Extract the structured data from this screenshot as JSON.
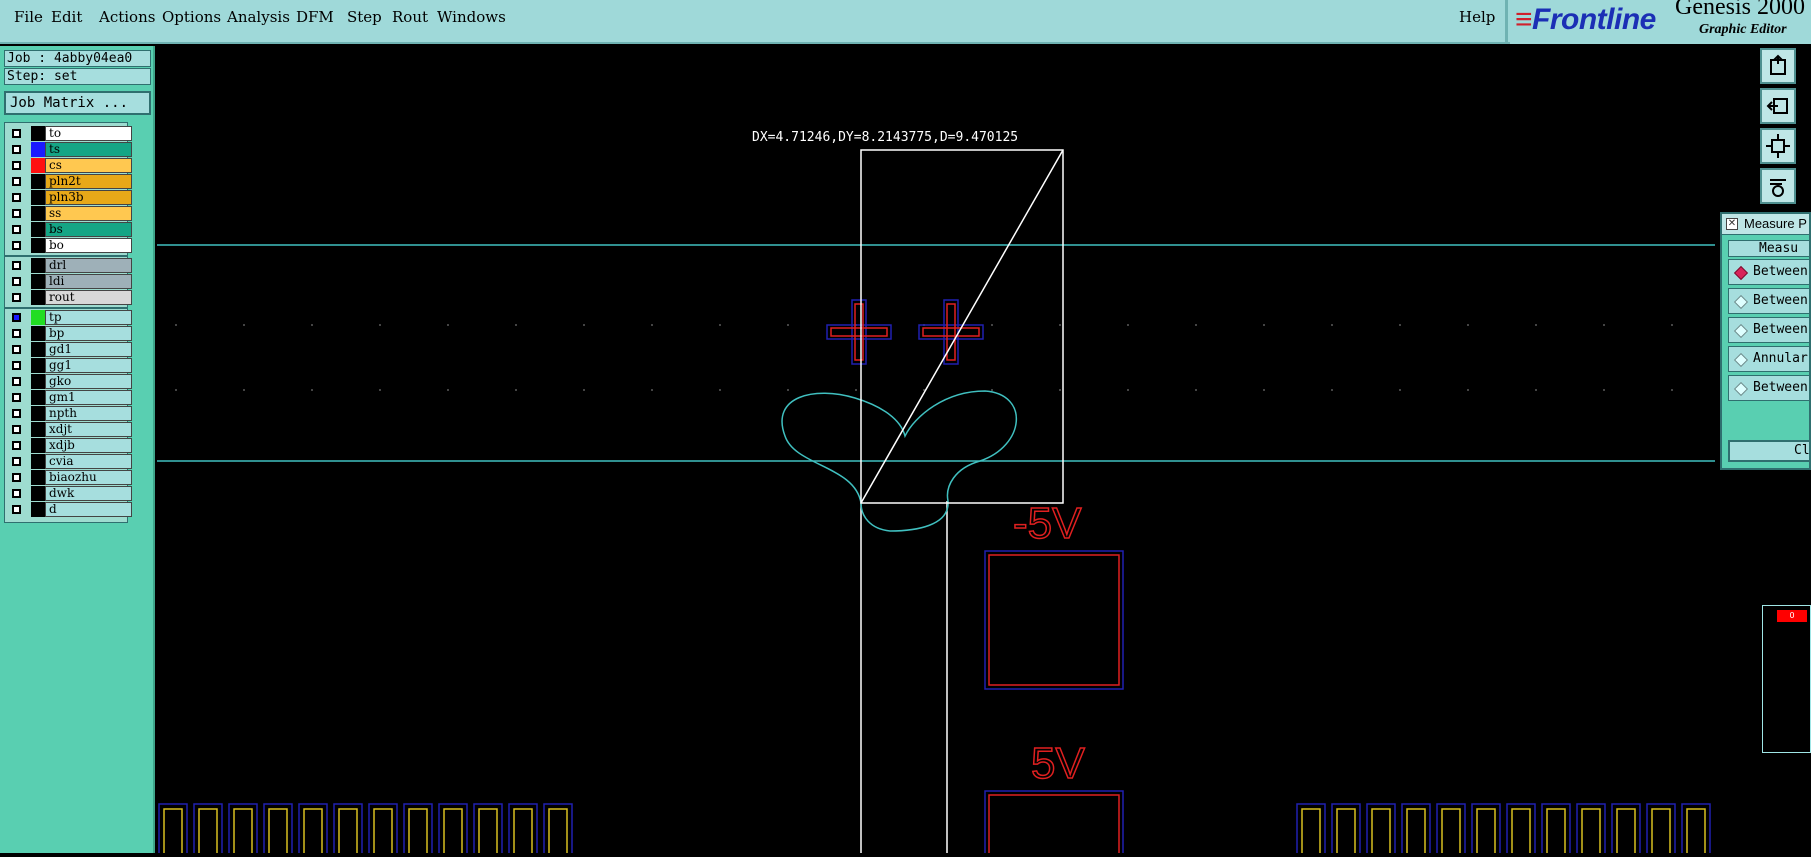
{
  "menubar": {
    "items": [
      {
        "label": "File"
      },
      {
        "label": "Edit"
      },
      {
        "label": "Actions"
      },
      {
        "label": "Options"
      },
      {
        "label": "Analysis"
      },
      {
        "label": "DFM"
      },
      {
        "label": "Step"
      },
      {
        "label": "Rout"
      },
      {
        "label": "Windows"
      }
    ],
    "help": "Help"
  },
  "brand": {
    "logo": "Frontline",
    "title": "Genesis 2000",
    "subtitle": "Graphic Editor"
  },
  "job_info": {
    "job": "Job : 4abby04ea0",
    "step": "Step: set",
    "job_matrix_button": "Job Matrix ..."
  },
  "layers": [
    {
      "name": "to",
      "swatch": "#000000",
      "bg": "#ffffff",
      "active": false
    },
    {
      "name": "ts",
      "swatch": "#1a1aff",
      "bg": "#15a585",
      "active": false
    },
    {
      "name": "cs",
      "swatch": "#ff1010",
      "bg": "#ffc850",
      "active": false
    },
    {
      "name": "pln2t",
      "swatch": "#000000",
      "bg": "#e8a818",
      "active": false
    },
    {
      "name": "pln3b",
      "swatch": "#000000",
      "bg": "#e8a818",
      "active": false
    },
    {
      "name": "ss",
      "swatch": "#000000",
      "bg": "#ffc850",
      "active": false
    },
    {
      "name": "bs",
      "swatch": "#000000",
      "bg": "#15a585",
      "active": false
    },
    {
      "name": "bo",
      "swatch": "#000000",
      "bg": "#ffffff",
      "active": false
    },
    {
      "name": "drl",
      "swatch": "#000000",
      "bg": "#9eb0b8",
      "active": false
    },
    {
      "name": "ldi",
      "swatch": "#000000",
      "bg": "#9eb0b8",
      "active": false
    },
    {
      "name": "rout",
      "swatch": "#000000",
      "bg": "#d8d8d8",
      "active": false
    },
    {
      "name": "tp",
      "swatch": "#22dd22",
      "bg": "#a6dede",
      "active": true
    },
    {
      "name": "bp",
      "swatch": "#000000",
      "bg": "#a6dede",
      "active": false
    },
    {
      "name": "gd1",
      "swatch": "#000000",
      "bg": "#a6dede",
      "active": false
    },
    {
      "name": "gg1",
      "swatch": "#000000",
      "bg": "#a6dede",
      "active": false
    },
    {
      "name": "gko",
      "swatch": "#000000",
      "bg": "#a6dede",
      "active": false
    },
    {
      "name": "gm1",
      "swatch": "#000000",
      "bg": "#a6dede",
      "active": false
    },
    {
      "name": "npth",
      "swatch": "#000000",
      "bg": "#a6dede",
      "active": false
    },
    {
      "name": "xdjt",
      "swatch": "#000000",
      "bg": "#a6dede",
      "active": false
    },
    {
      "name": "xdjb",
      "swatch": "#000000",
      "bg": "#a6dede",
      "active": false
    },
    {
      "name": "cvia",
      "swatch": "#000000",
      "bg": "#a6dede",
      "active": false
    },
    {
      "name": "biaozhu",
      "swatch": "#000000",
      "bg": "#a6dede",
      "active": false
    },
    {
      "name": "dwk",
      "swatch": "#000000",
      "bg": "#a6dede",
      "active": false
    },
    {
      "name": "d",
      "swatch": "#000000",
      "bg": "#a6dede",
      "active": false
    }
  ],
  "canvas": {
    "measure_readout": "DX=4.71246,DY=8.2143775,D=9.470125",
    "labels": [
      "-5V",
      "5V"
    ]
  },
  "measure_popup": {
    "title": "Measure P",
    "header": "Measu",
    "options": [
      {
        "label": "Between",
        "selected": true
      },
      {
        "label": "Between",
        "selected": false
      },
      {
        "label": "Between",
        "selected": false
      },
      {
        "label": "Annular",
        "selected": false
      },
      {
        "label": "Between",
        "selected": false
      }
    ],
    "close_label": "Cl"
  },
  "right_toolbar": {
    "icons": [
      "zoom-home-icon",
      "zoom-back-icon",
      "zoom-fit-icon",
      "tool-settings-icon"
    ]
  },
  "overview": {
    "badge": "0"
  },
  "colors": {
    "menubar_bg": "#9fd9d9",
    "panel_bg": "#59cfb1",
    "pad_red": "#e02020",
    "pad_blue": "#2020b0",
    "outline_cyan": "#40c0c0",
    "measure_white": "#ffffff"
  }
}
